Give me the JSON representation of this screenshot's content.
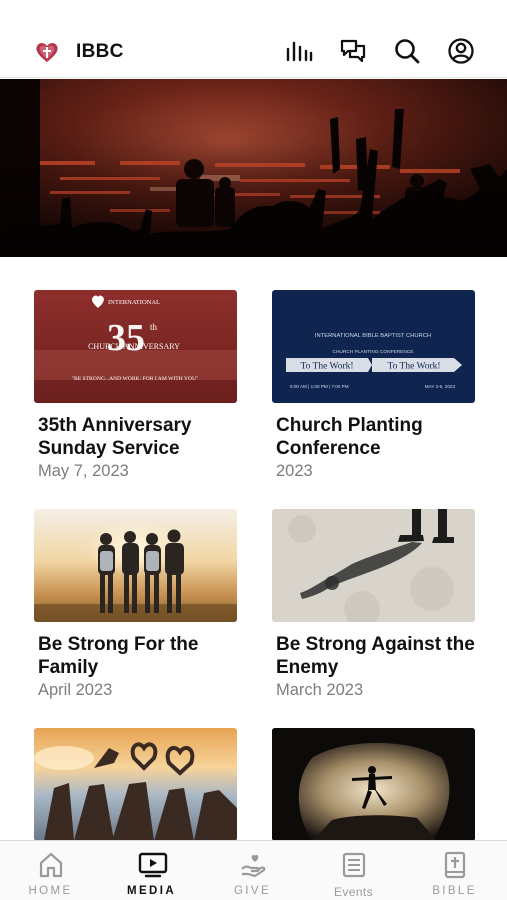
{
  "header": {
    "title": "IBBC",
    "icons": [
      "bars-icon",
      "chat-icon",
      "search-icon",
      "account-icon"
    ]
  },
  "cards": [
    {
      "title": "35th Anniversary Sunday Service",
      "date": "May 7, 2023",
      "thumb": {
        "logo_text": "INTERNATIONAL",
        "number": "35",
        "number_suffix": "th",
        "subtitle": "CHURCH ANNIVERSARY",
        "motto": "\"BE STRONG...AND WORK: FOR I AM WITH YOU\""
      }
    },
    {
      "title": "Church Planting Conference",
      "date": "2023",
      "thumb": {
        "line1": "INTERNATIONAL BIBLE BAPTIST CHURCH",
        "line2": "CHURCH PLANTING CONFERENCE",
        "left_banner": "To The Work!",
        "right_banner": "To The Work!",
        "times": "9:00 AM | 1:00 PM | 7:00 PM",
        "dates": "MAY 3-5, 2023"
      }
    },
    {
      "title": "Be Strong For the Family",
      "date": "April 2023"
    },
    {
      "title": "Be Strong Against the Enemy",
      "date": "March 2023"
    },
    {
      "title": "",
      "date": ""
    },
    {
      "title": "",
      "date": ""
    }
  ],
  "tabs": [
    {
      "label": "HOME",
      "icon": "home-icon",
      "active": false
    },
    {
      "label": "MEDIA",
      "icon": "media-icon",
      "active": true
    },
    {
      "label": "GIVE",
      "icon": "give-icon",
      "active": false
    },
    {
      "label": "Events",
      "icon": "events-icon",
      "active": false
    },
    {
      "label": "BIBLE",
      "icon": "bible-icon",
      "active": false
    }
  ],
  "colors": {
    "active_tab": "#111111",
    "inactive_tab": "#9a9a9a",
    "date_text": "#7d7d7d"
  }
}
